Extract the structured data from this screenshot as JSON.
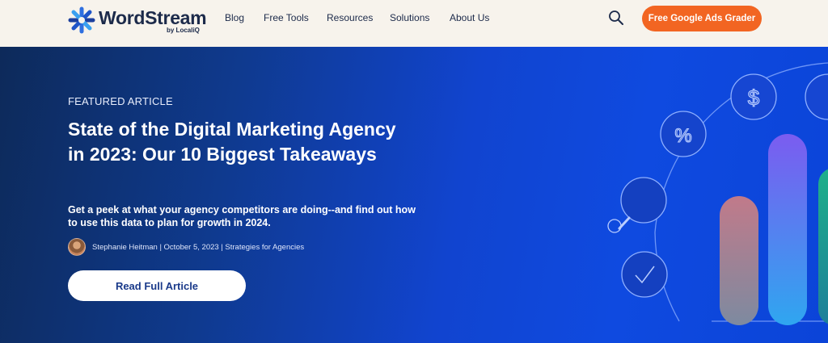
{
  "brand": {
    "name": "WordStream",
    "sub": "by LocaliQ"
  },
  "nav": {
    "items": [
      {
        "label": "Blog"
      },
      {
        "label": "Free Tools"
      },
      {
        "label": "Resources"
      },
      {
        "label": "Solutions"
      },
      {
        "label": "About Us"
      }
    ],
    "cta_label": "Free Google Ads Grader"
  },
  "hero": {
    "eyebrow": "FEATURED ARTICLE",
    "title": "State of the Digital Marketing Agency in 2023: Our 10 Biggest Takeaways",
    "subtitle": "Get a peek at what your agency competitors are doing--and find out how to use this data to plan for growth in 2024.",
    "byline": "Stephanie Heitman | October 5, 2023 | Strategies for Agencies",
    "button_label": "Read Full Article"
  },
  "colors": {
    "accent": "#f26522",
    "navy": "#1c2a4a",
    "hero_blue": "#1144cf"
  },
  "icons": [
    "wordstream-logo-icon",
    "search-icon",
    "dollar-icon",
    "percent-icon",
    "magnifier-icon",
    "checkmark-icon"
  ]
}
